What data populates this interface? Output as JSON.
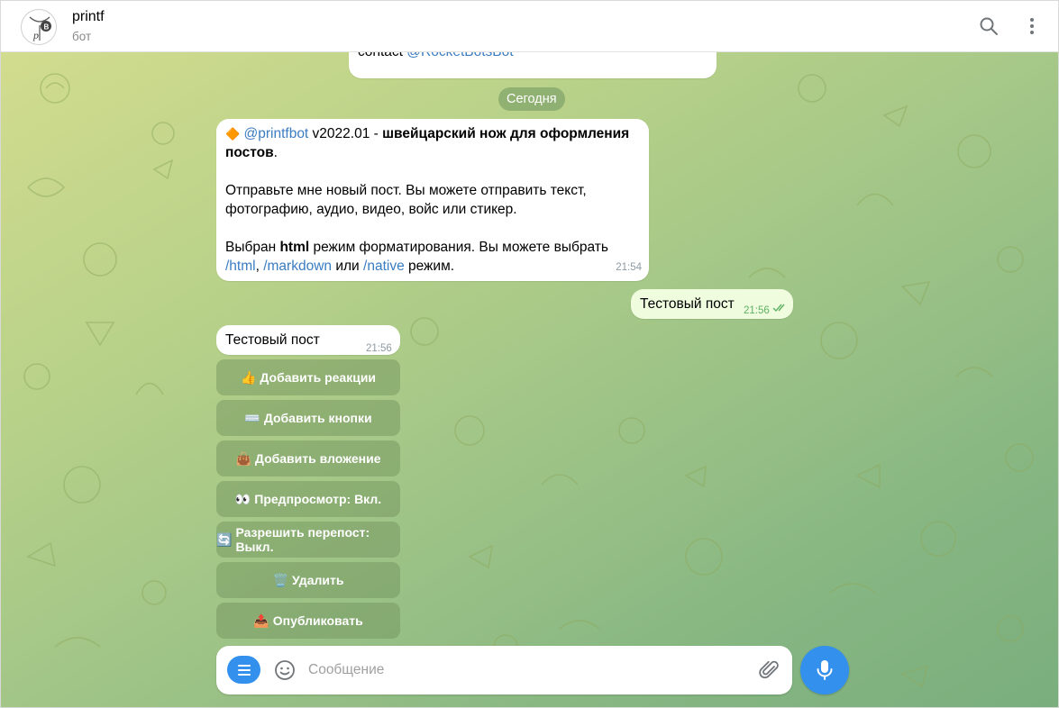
{
  "header": {
    "title": "printf",
    "subtitle": "бот",
    "avatar_letters": "B p"
  },
  "chat": {
    "top_message": {
      "prefix": "contact ",
      "link": "@RocketBotsBot"
    },
    "date_chip": "Сегодня",
    "bot_intro": {
      "icon": "🔶",
      "handle": "@printfbot",
      "version": " v2022.01 - ",
      "title": "швейцарский нож для оформления постов",
      "title_end": ".",
      "para2": "Отправьте мне новый пост. Вы можете отправить текст, фотографию, аудио, видео, войс или стикер.",
      "para3_prefix": "Выбран ",
      "para3_bold": "html",
      "para3_mid": " режим форматирования. Вы можете выбрать ",
      "cmd_html": "/html",
      "sep1": ", ",
      "cmd_markdown": "/markdown",
      "sep2": " или ",
      "cmd_native": "/native",
      "para3_end": " режим.",
      "time": "21:54"
    },
    "outgoing": {
      "text": "Тестовый пост",
      "time": "21:56"
    },
    "bot_reply": {
      "text": "Тестовый пост",
      "time": "21:56"
    },
    "keyboard": [
      {
        "emoji": "👍",
        "label": "Добавить реакции"
      },
      {
        "emoji": "⌨️",
        "label": "Добавить кнопки"
      },
      {
        "emoji": "👜",
        "label": "Добавить вложение"
      },
      {
        "emoji": "👀",
        "label": "Предпросмотр: Вкл."
      },
      {
        "emoji": "🔄",
        "label": "Разрешить перепост: Выкл."
      },
      {
        "emoji": "🗑️",
        "label": "Удалить"
      },
      {
        "emoji": "📤",
        "label": "Опубликовать"
      }
    ]
  },
  "composer": {
    "placeholder": "Сообщение"
  },
  "colors": {
    "accent": "#3390ec",
    "outgoing_bubble": "#effdde",
    "link": "#3a7cc1"
  }
}
